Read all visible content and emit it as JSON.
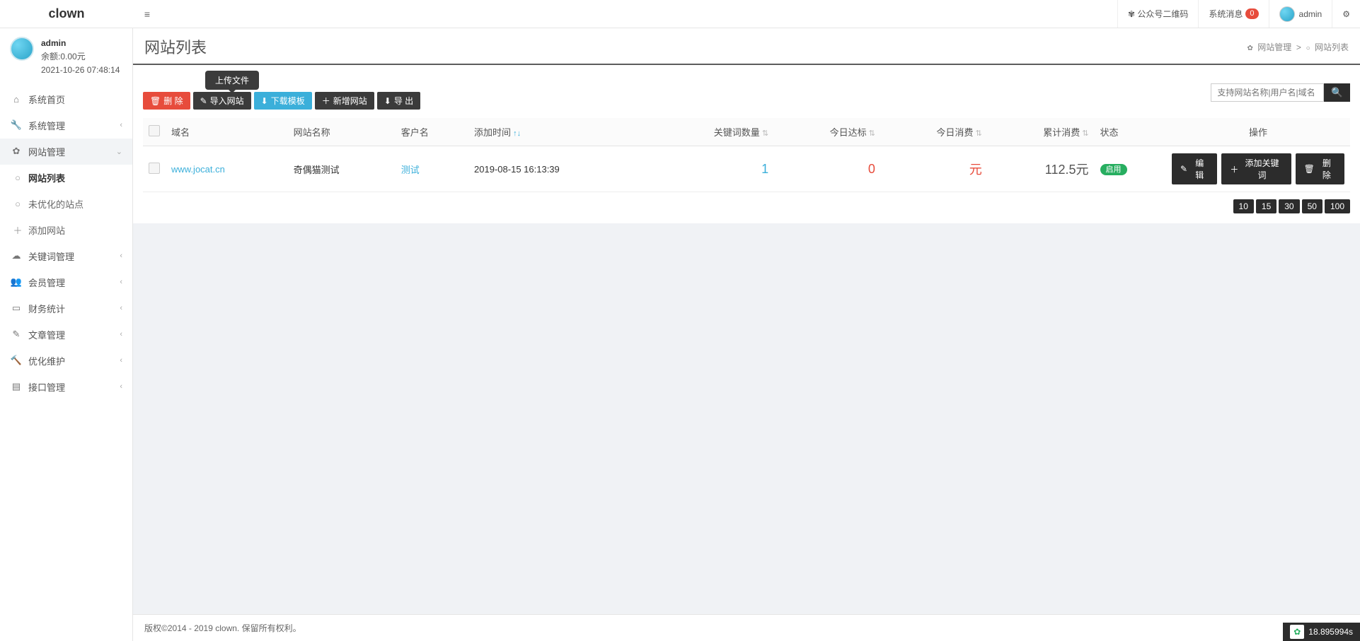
{
  "brand": "clown",
  "topbar": {
    "wechat": "公众号二维码",
    "sysmsg": "系统消息",
    "sysmsg_count": "0",
    "user": "admin"
  },
  "sidebar_user": {
    "name": "admin",
    "balance": "余额:0.00元",
    "time": "2021-10-26 07:48:14"
  },
  "menu": {
    "home": "系统首页",
    "sys": "系统管理",
    "site": "网站管理",
    "sub_site_list": "网站列表",
    "sub_unopt": "未优化的站点",
    "sub_add": "添加网站",
    "keyword": "关键词管理",
    "member": "会员管理",
    "finance": "财务统计",
    "article": "文章管理",
    "opt": "优化维护",
    "api": "接口管理"
  },
  "page": {
    "title": "网站列表",
    "bc1": "网站管理",
    "bc_sep": ">",
    "bc2": "网站列表"
  },
  "tooltip_upload": "上传文件",
  "toolbar": {
    "delete": "删 除",
    "import": "导入网站",
    "download_tpl": "下载模板",
    "add_site": "新增网站",
    "export": "导 出"
  },
  "search": {
    "placeholder": "支持网站名称|用户名|域名"
  },
  "table": {
    "headers": {
      "domain": "域名",
      "site_name": "网站名称",
      "customer": "客户名",
      "add_time": "添加时间",
      "keyword_count": "关键词数量",
      "today_reach": "今日达标",
      "today_cost": "今日消费",
      "total_cost": "累计消费",
      "status": "状态",
      "action": "操作"
    },
    "row": {
      "domain": "www.jocat.cn",
      "site_name": "奇偶猫测试",
      "customer": "测试",
      "add_time": "2019-08-15 16:13:39",
      "keyword_count": "1",
      "today_reach": "0",
      "today_cost": "元",
      "total_cost": "112.5元",
      "status": "启用"
    },
    "actions": {
      "edit": "编 辑",
      "add_keyword": "添加关键词",
      "delete": "删 除"
    }
  },
  "pager": [
    "10",
    "15",
    "30",
    "50",
    "100"
  ],
  "footer": "版权©2014 - 2019 clown. 保留所有权利。",
  "perf": "18.895994s"
}
